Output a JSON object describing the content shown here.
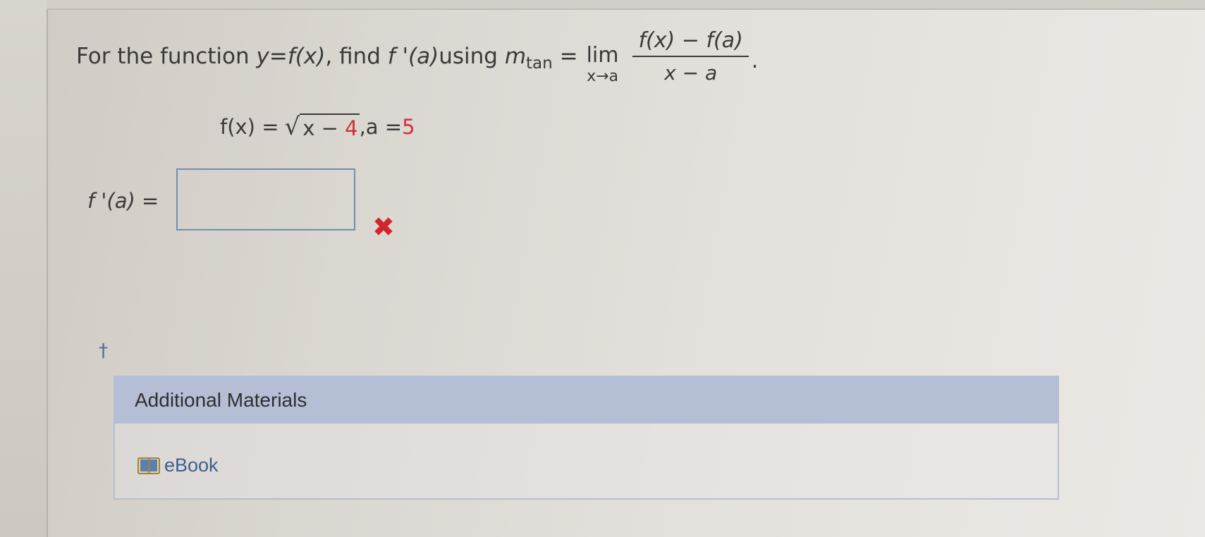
{
  "question": {
    "prefix": "For the function ",
    "y": "y",
    "eq1": " = ",
    "fx": "f(x)",
    "mid": ", find ",
    "fprime": "f '(a)",
    "using": " using ",
    "m": "m",
    "tan": "tan",
    "eq2": " = ",
    "lim": "lim",
    "lim_sub": "x→a",
    "numerator": "f(x) − f(a)",
    "denominator": "x − a",
    "period": "."
  },
  "function": {
    "lhs": "f(x) = ",
    "radicand_x": "x − ",
    "radicand_num": "4",
    "comma": ", ",
    "a_label": "a = ",
    "a_value": "5"
  },
  "answer": {
    "label": "f '(a)",
    "eq": " =",
    "value": "",
    "status_icon": "x-mark-icon",
    "status_color": "#d4252f"
  },
  "footnote": {
    "dagger": "†"
  },
  "additional_materials": {
    "title": "Additional Materials",
    "ebook_label": "eBook",
    "ebook_icon": "book-icon"
  }
}
